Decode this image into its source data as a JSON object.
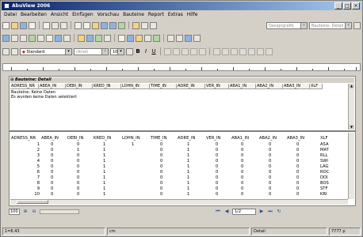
{
  "app": {
    "title": "AbuView 2006",
    "window_buttons": [
      "_",
      "□",
      "×"
    ]
  },
  "menu": [
    "Datei",
    "Bearbeiten",
    "Ansicht",
    "Einfügen",
    "Vorschau",
    "Bauteine",
    "Report",
    "Extras",
    "Hilfe"
  ],
  "toolbar1": {
    "dropdown1": "Designgrafik",
    "dropdown2": "Bauteine: Detail"
  },
  "toolbar2": {},
  "format_bar": {
    "style": "Standard",
    "font": "(Arial)",
    "size": "10",
    "bold": "B",
    "italic": "I",
    "underline": "U"
  },
  "detail_panel": {
    "title": "Bauteine: Detail",
    "columns": [
      "ADRESS_NR",
      "ABEA_IN",
      "DEBI_IN",
      "KRED_IN",
      "LOHN_IN",
      "TIME_IN",
      "ADRE_IN",
      "VER_IN",
      "ABA1_IN",
      "ABA2_IN",
      "ABA3_IN",
      "XLF"
    ],
    "info_line1": "Bauteine: Keine Daten",
    "info_line2": "Es wurden keine Daten selektiert"
  },
  "grid": {
    "columns": [
      "ADRESS_NR",
      "ABEA_IN",
      "DEBI_IN",
      "KRED_IN",
      "LOHN_IN",
      "TIME_IN",
      "ADRE_IN",
      "VER_IN",
      "ABA1_IN",
      "ABA2_IN",
      "ABA3_IN",
      "XLF"
    ],
    "rows": [
      [
        "1",
        "0",
        "0",
        "1",
        "1",
        "0",
        "1",
        "0",
        "0",
        "0",
        "0",
        "ASA"
      ],
      [
        "2",
        "0",
        "1",
        "1",
        "",
        "0",
        "1",
        "0",
        "0",
        "0",
        "0",
        "MAT"
      ],
      [
        "3",
        "0",
        "0",
        "1",
        "",
        "0",
        "1",
        "0",
        "0",
        "0",
        "0",
        "RLL"
      ],
      [
        "4",
        "0",
        "0",
        "1",
        "",
        "0",
        "1",
        "0",
        "0",
        "0",
        "0",
        "SWI"
      ],
      [
        "5",
        "0",
        "0",
        "1",
        "",
        "0",
        "1",
        "0",
        "0",
        "0",
        "0",
        "LAG"
      ],
      [
        "6",
        "0",
        "0",
        "1",
        "",
        "0",
        "1",
        "0",
        "0",
        "0",
        "0",
        "ROC"
      ],
      [
        "7",
        "0",
        "0",
        "1",
        "",
        "0",
        "1",
        "0",
        "0",
        "0",
        "0",
        "DOI"
      ],
      [
        "8",
        "0",
        "0",
        "1",
        "",
        "0",
        "1",
        "0",
        "0",
        "0",
        "0",
        "BOS"
      ],
      [
        "9",
        "0",
        "0",
        "1",
        "",
        "0",
        "1",
        "0",
        "0",
        "0",
        "0",
        "STF"
      ],
      [
        "10",
        "0",
        "0",
        "1",
        "",
        "0",
        "1",
        "0",
        "0",
        "0",
        "0",
        "KRI"
      ]
    ]
  },
  "navigation": {
    "zoom": "100",
    "page": "1/2"
  },
  "status": {
    "position": "1=6.43",
    "unit": "cm",
    "mode": "Detail",
    "memory": "7777 p"
  }
}
